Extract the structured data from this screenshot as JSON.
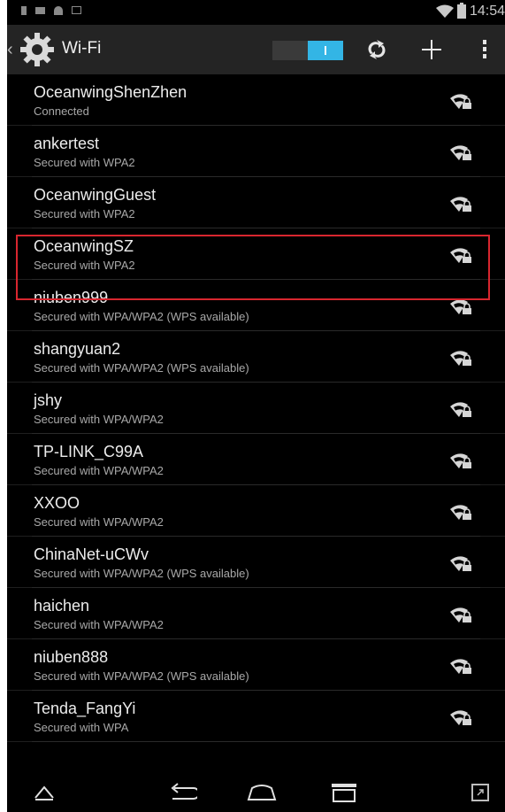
{
  "status_bar": {
    "time": "14:54",
    "icons": [
      "notification-icon",
      "image-icon",
      "cloud-icon",
      "screenshot-icon",
      "wifi-signal-icon",
      "battery-icon"
    ]
  },
  "action_bar": {
    "title": "Wi-Fi",
    "toggle_state": "on",
    "accent_color": "#33b5e5",
    "icons": [
      "settings-gear-icon",
      "wps-icon",
      "add-network-icon",
      "overflow-menu-icon"
    ]
  },
  "networks": [
    {
      "ssid": "OceanwingShenZhen",
      "status": "Connected"
    },
    {
      "ssid": "ankertest",
      "status": "Secured with WPA2"
    },
    {
      "ssid": "OceanwingGuest",
      "status": "Secured with WPA2"
    },
    {
      "ssid": "OceanwingSZ",
      "status": "Secured with WPA2"
    },
    {
      "ssid": "niuben999",
      "status": "Secured with WPA/WPA2 (WPS available)"
    },
    {
      "ssid": "shangyuan2",
      "status": "Secured with WPA/WPA2 (WPS available)"
    },
    {
      "ssid": "jshy",
      "status": "Secured with WPA/WPA2"
    },
    {
      "ssid": "TP-LINK_C99A",
      "status": "Secured with WPA/WPA2"
    },
    {
      "ssid": "XXOO",
      "status": "Secured with WPA/WPA2"
    },
    {
      "ssid": "ChinaNet-uCWv",
      "status": "Secured with WPA/WPA2 (WPS available)"
    },
    {
      "ssid": "haichen",
      "status": "Secured with WPA/WPA2"
    },
    {
      "ssid": "niuben888",
      "status": "Secured with WPA/WPA2 (WPS available)"
    },
    {
      "ssid": "Tenda_FangYi",
      "status": "Secured with WPA"
    }
  ],
  "nav_bar": {
    "icons": [
      "hide-keyboard-icon",
      "back-icon",
      "home-icon",
      "recents-icon",
      "fullscreen-icon"
    ]
  },
  "highlight_color": "#d8262f"
}
